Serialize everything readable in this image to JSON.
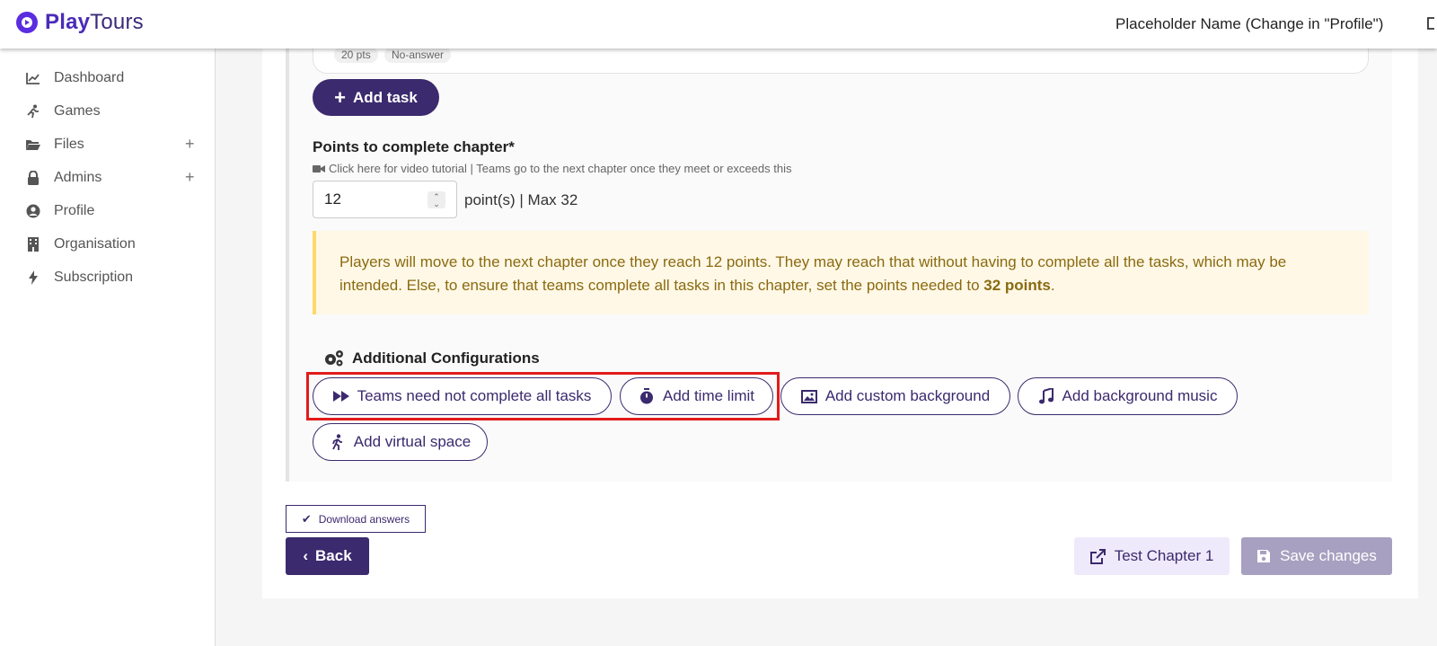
{
  "app": {
    "logo_play": "Play",
    "logo_tours": "Tours",
    "user_name": "Placeholder Name (Change in \"Profile\")"
  },
  "sidebar": {
    "items": [
      {
        "label": "Dashboard",
        "icon": "chart-line-icon"
      },
      {
        "label": "Games",
        "icon": "running-icon"
      },
      {
        "label": "Files",
        "icon": "folder-open-icon",
        "expandable": "+"
      },
      {
        "label": "Admins",
        "icon": "lock-icon",
        "expandable": "+"
      },
      {
        "label": "Profile",
        "icon": "user-circle-icon"
      },
      {
        "label": "Organisation",
        "icon": "building-icon"
      },
      {
        "label": "Subscription",
        "icon": "bolt-icon"
      }
    ]
  },
  "task": {
    "tags": [
      "20 pts",
      "No-answer"
    ]
  },
  "add_task_label": "Add task",
  "points": {
    "title": "Points to complete chapter*",
    "help": "Click here for video tutorial | Teams go to the next chapter once they meet or exceeds this",
    "value": "12",
    "suffix": "point(s) | Max 32"
  },
  "warning": {
    "text_before": "Players will move to the next chapter once they reach 12 points. They may reach that without having to complete all the tasks, which may be intended. Else, to ensure that teams complete all tasks in this chapter, set the points needed to ",
    "bold": "32 points",
    "text_after": "."
  },
  "config": {
    "title": "Additional Configurations",
    "buttons": [
      {
        "label": "Teams need not complete all tasks",
        "icon": "fast-forward-icon"
      },
      {
        "label": "Add time limit",
        "icon": "stopwatch-icon"
      },
      {
        "label": "Add custom background",
        "icon": "image-icon"
      },
      {
        "label": "Add background music",
        "icon": "music-icon"
      },
      {
        "label": "Add virtual space",
        "icon": "walking-icon"
      }
    ]
  },
  "actions": {
    "download": "Download answers",
    "back": "Back",
    "test": "Test Chapter 1",
    "save": "Save changes"
  },
  "colors": {
    "brand": "#3b2a6e",
    "highlight": "#e21b1b",
    "warning_bg": "#fff8e6",
    "warning_text": "#8a6a10"
  }
}
